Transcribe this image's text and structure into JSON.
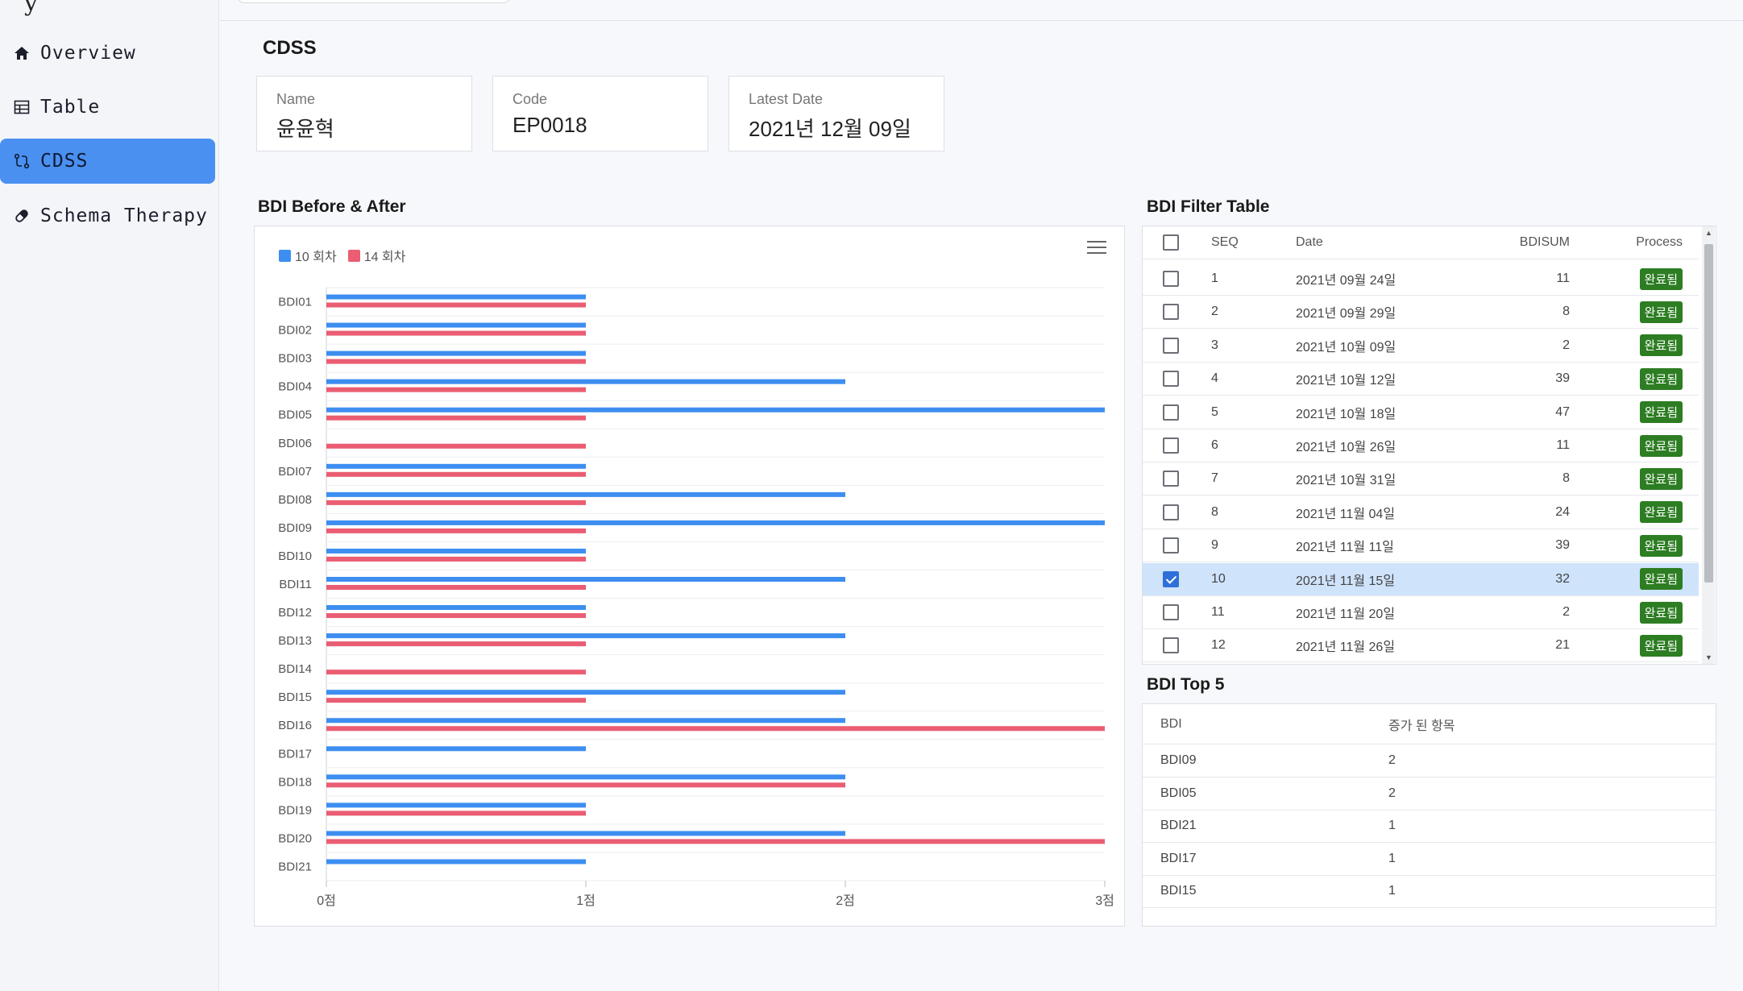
{
  "sidebar": {
    "logo_glyph": "y",
    "items": [
      {
        "label": "Overview",
        "icon": "home-icon"
      },
      {
        "label": "Table",
        "icon": "table-icon"
      },
      {
        "label": "CDSS",
        "icon": "compare-icon",
        "active": true
      },
      {
        "label": "Schema Therapy",
        "icon": "pill-icon"
      }
    ]
  },
  "page": {
    "title": "CDSS",
    "cards": [
      {
        "label": "Name",
        "value": "윤윤혁"
      },
      {
        "label": "Code",
        "value": "EP0018"
      },
      {
        "label": "Latest Date",
        "value": "2021년 12월 09일"
      }
    ]
  },
  "chart_section": {
    "title": "BDI Before & After"
  },
  "chart_data": {
    "type": "bar",
    "orientation": "horizontal",
    "categories": [
      "BDI01",
      "BDI02",
      "BDI03",
      "BDI04",
      "BDI05",
      "BDI06",
      "BDI07",
      "BDI08",
      "BDI09",
      "BDI10",
      "BDI11",
      "BDI12",
      "BDI13",
      "BDI14",
      "BDI15",
      "BDI16",
      "BDI17",
      "BDI18",
      "BDI19",
      "BDI20",
      "BDI21"
    ],
    "series": [
      {
        "name": "10 회차",
        "color": "#3d8ef0",
        "values": [
          1,
          1,
          1,
          2,
          3,
          0,
          1,
          2,
          3,
          1,
          2,
          1,
          2,
          0,
          2,
          2,
          1,
          2,
          1,
          2,
          1
        ]
      },
      {
        "name": "14 회차",
        "color": "#ea5d72",
        "values": [
          1,
          1,
          1,
          1,
          1,
          1,
          1,
          1,
          1,
          1,
          1,
          1,
          1,
          1,
          1,
          3,
          0,
          2,
          1,
          3,
          0
        ]
      }
    ],
    "x_ticks": [
      "0점",
      "1점",
      "2점",
      "3점"
    ],
    "xlim": [
      0,
      3
    ],
    "legend": "top-left",
    "grid": true
  },
  "filter_table": {
    "title": "BDI Filter Table",
    "headers": {
      "seq": "SEQ",
      "date": "Date",
      "sum": "BDISUM",
      "process": "Process"
    },
    "rows": [
      {
        "seq": "1",
        "date": "2021년 09월 24일",
        "sum": "11",
        "process": "완료됨",
        "checked": false
      },
      {
        "seq": "2",
        "date": "2021년 09월 29일",
        "sum": "8",
        "process": "완료됨",
        "checked": false
      },
      {
        "seq": "3",
        "date": "2021년 10월 09일",
        "sum": "2",
        "process": "완료됨",
        "checked": false
      },
      {
        "seq": "4",
        "date": "2021년 10월 12일",
        "sum": "39",
        "process": "완료됨",
        "checked": false
      },
      {
        "seq": "5",
        "date": "2021년 10월 18일",
        "sum": "47",
        "process": "완료됨",
        "checked": false
      },
      {
        "seq": "6",
        "date": "2021년 10월 26일",
        "sum": "11",
        "process": "완료됨",
        "checked": false
      },
      {
        "seq": "7",
        "date": "2021년 10월 31일",
        "sum": "8",
        "process": "완료됨",
        "checked": false
      },
      {
        "seq": "8",
        "date": "2021년 11월 04일",
        "sum": "24",
        "process": "완료됨",
        "checked": false
      },
      {
        "seq": "9",
        "date": "2021년 11월 11일",
        "sum": "39",
        "process": "완료됨",
        "checked": false
      },
      {
        "seq": "10",
        "date": "2021년 11월 15일",
        "sum": "32",
        "process": "완료됨",
        "checked": true
      },
      {
        "seq": "11",
        "date": "2021년 11월 20일",
        "sum": "2",
        "process": "완료됨",
        "checked": false
      },
      {
        "seq": "12",
        "date": "2021년 11월 26일",
        "sum": "21",
        "process": "완료됨",
        "checked": false
      }
    ]
  },
  "top5": {
    "title": "BDI Top 5",
    "headers": {
      "bdi": "BDI",
      "increase": "증가 된 항목"
    },
    "rows": [
      {
        "bdi": "BDI09",
        "value": "2"
      },
      {
        "bdi": "BDI05",
        "value": "2"
      },
      {
        "bdi": "BDI21",
        "value": "1"
      },
      {
        "bdi": "BDI17",
        "value": "1"
      },
      {
        "bdi": "BDI15",
        "value": "1"
      }
    ]
  }
}
